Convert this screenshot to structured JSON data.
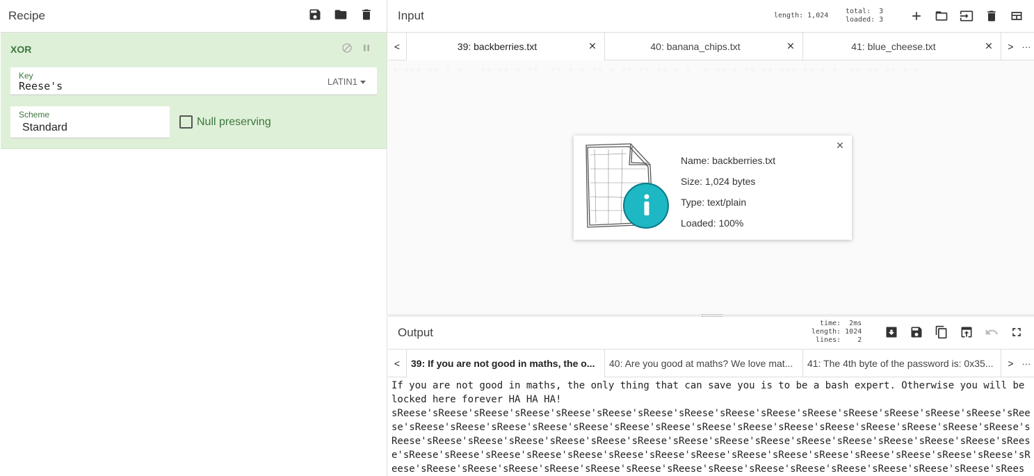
{
  "recipe": {
    "title": "Recipe",
    "operation": {
      "name": "XOR",
      "key_label": "Key",
      "key_value": "Reese's",
      "key_encoding": "LATIN1",
      "scheme_label": "Scheme",
      "scheme_value": "Standard",
      "null_preserving_label": "Null preserving",
      "null_preserving_checked": false
    }
  },
  "input": {
    "title": "Input",
    "stats": "length: 1,024",
    "counts": "total:  3\nloaded: 3",
    "tabs": [
      {
        "label": "39: backberries.txt",
        "active": true
      },
      {
        "label": "40: banana_chips.txt",
        "active": false
      },
      {
        "label": "41: blue_cheese.txt",
        "active": false
      }
    ],
    "prev": "<",
    "next": ">",
    "more": "···",
    "file": {
      "name": "Name: backberries.txt",
      "size": "Size: 1,024 bytes",
      "type": "Type: text/plain",
      "loaded": "Loaded: 100%"
    }
  },
  "output": {
    "title": "Output",
    "stats": "  time:  2ms\nlength: 1024\n lines:    2",
    "tabs": [
      {
        "label": "39: If you are not good in maths, the o...",
        "active": true
      },
      {
        "label": "40: Are you good at maths? We love mat...",
        "active": false
      },
      {
        "label": "41: The 4th byte of the password is: 0x35...",
        "active": false
      }
    ],
    "prev": "<",
    "next": ">",
    "more": "···",
    "line1": "If you are not good in maths, the only thing that can save you is to be a bash expert. Otherwise you will be locked here forever HA HA HA!",
    "line2": "sReese'sReese'sReese'sReese'sReese'sReese'sReese'sReese'sReese'sReese'sReese'sReese'sReese'sReese'sReese'sReese'sReese'sReese'sReese'sReese'sReese'sReese'sReese'sReese'sReese'sReese'sReese'sReese'sReese'sReese'sReese'sReese'sReese'sReese'sReese'sReese'sReese'sReese'sReese'sReese'sReese'sReese'sReese'sReese'sReese'sReese'sReese'sReese'sReese'sReese'sReese'sReese'sReese'sReese'sReese'sReese'sReese'sReese'sReese'sReese'sReese'sReese'sReese'sReese'sReese'sReese'sReese'sReese'sReese'sReese'sReese'sReese'sReese'sReese'sReese'sReese'sReese'sReese'sReese'sReese'sReese'sReese'"
  },
  "colors": {
    "operation_bg": "#dff0d8",
    "accent_green": "#3c763d"
  }
}
